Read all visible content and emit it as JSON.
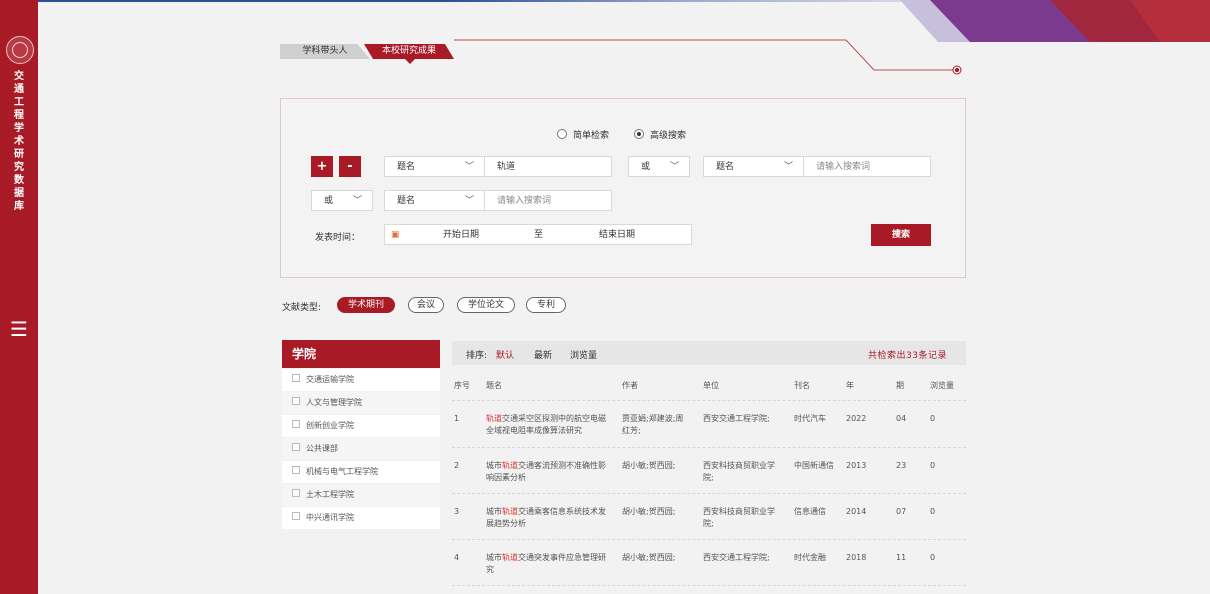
{
  "app": {
    "title": "交通工程学术研究数据库"
  },
  "tabs": [
    {
      "label": "学科带头人"
    },
    {
      "label": "本校研究成果"
    }
  ],
  "search": {
    "mode_simple": "简单检索",
    "mode_advanced": "高级搜索",
    "add": "+",
    "remove": "-",
    "row1": {
      "field1": "题名",
      "value1": "轨道",
      "logic": "或",
      "field2": "题名",
      "placeholder2": "请输入搜索词"
    },
    "row2": {
      "logic": "或",
      "field": "题名",
      "placeholder": "请输入搜索词"
    },
    "date": {
      "label": "发表时间：",
      "start": "开始日期",
      "to": "至",
      "end": "结束日期"
    },
    "submit": "搜索"
  },
  "filters": {
    "label": "文献类型:",
    "types": [
      "学术期刊",
      "会议",
      "学位论文",
      "专利"
    ]
  },
  "sidebar": {
    "title": "学院",
    "items": [
      "交通运输学院",
      "人文与管理学院",
      "创新创业学院",
      "公共课部",
      "机械与电气工程学院",
      "土木工程学院",
      "中兴通讯学院"
    ]
  },
  "results": {
    "sort_label": "排序:",
    "sort_options": [
      "默认",
      "最新",
      "浏览量"
    ],
    "count_text": "共检索出33条记录",
    "columns": [
      "序号",
      "题名",
      "作者",
      "单位",
      "刊名",
      "年",
      "期",
      "浏览量"
    ],
    "highlight": "轨道",
    "rows": [
      {
        "no": "1",
        "title_pre": "",
        "title_post": "交通采空区探测中的航空电磁全域视电阻率成像算法研究",
        "author": "贾亚娟;郑建波;周红芳;",
        "unit": "西安交通工程学院;",
        "journal": "时代汽车",
        "year": "2022",
        "issue": "04",
        "views": "0"
      },
      {
        "no": "2",
        "title_pre": "城市",
        "title_post": "交通客流预测不准确性影响因素分析",
        "author": "胡小敏;贺西园;",
        "unit": "西安科技商贸职业学院;",
        "journal": "中国新通信",
        "year": "2013",
        "issue": "23",
        "views": "0"
      },
      {
        "no": "3",
        "title_pre": "城市",
        "title_post": "交通乘客信息系统技术发展趋势分析",
        "author": "胡小敏;贺西园;",
        "unit": "西安科技商贸职业学院;",
        "journal": "信息通信",
        "year": "2014",
        "issue": "07",
        "views": "0"
      },
      {
        "no": "4",
        "title_pre": "城市",
        "title_post": "交通突发事件应急管理研究",
        "author": "胡小敏;贺西园;",
        "unit": "西安交通工程学院;",
        "journal": "时代金融",
        "year": "2018",
        "issue": "11",
        "views": "0"
      }
    ]
  },
  "colors": {
    "brand_red": "#a81b26",
    "highlight": "#e0312f"
  }
}
